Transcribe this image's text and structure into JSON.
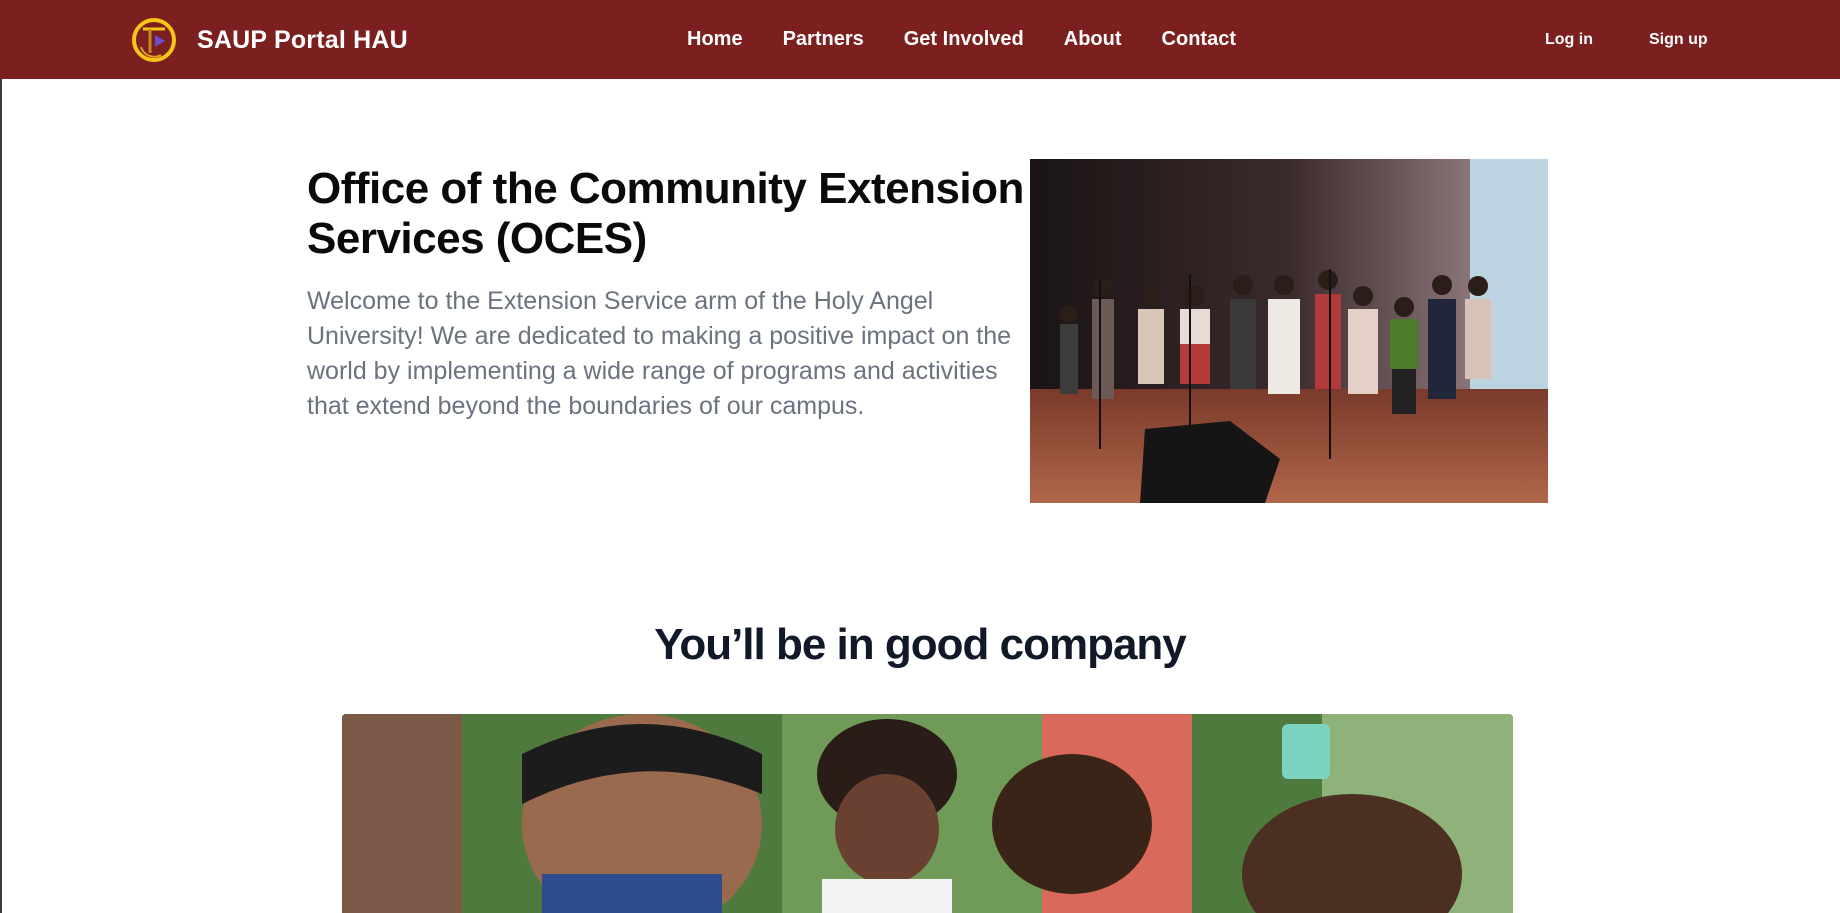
{
  "header": {
    "brand_name": "SAUP Portal HAU",
    "logo_icon": "university-seal-icon",
    "nav": [
      {
        "label": "Home"
      },
      {
        "label": "Partners"
      },
      {
        "label": "Get Involved"
      },
      {
        "label": "About"
      },
      {
        "label": "Contact"
      }
    ],
    "login_label": "Log in",
    "signup_label": "Sign up",
    "bg_color": "#7b1f1f"
  },
  "hero": {
    "title": "Office of the Community Extension Services (OCES)",
    "description": "Welcome to the Extension Service arm of the Holy Angel University! We are dedicated to making a positive impact on the world by implementing a wide range of programs and activities that extend beyond the boundaries of our campus.",
    "photo_icon": "children-choir-photo"
  },
  "company": {
    "title": "You’ll be in good company",
    "photo_icon": "community-outreach-photo"
  }
}
